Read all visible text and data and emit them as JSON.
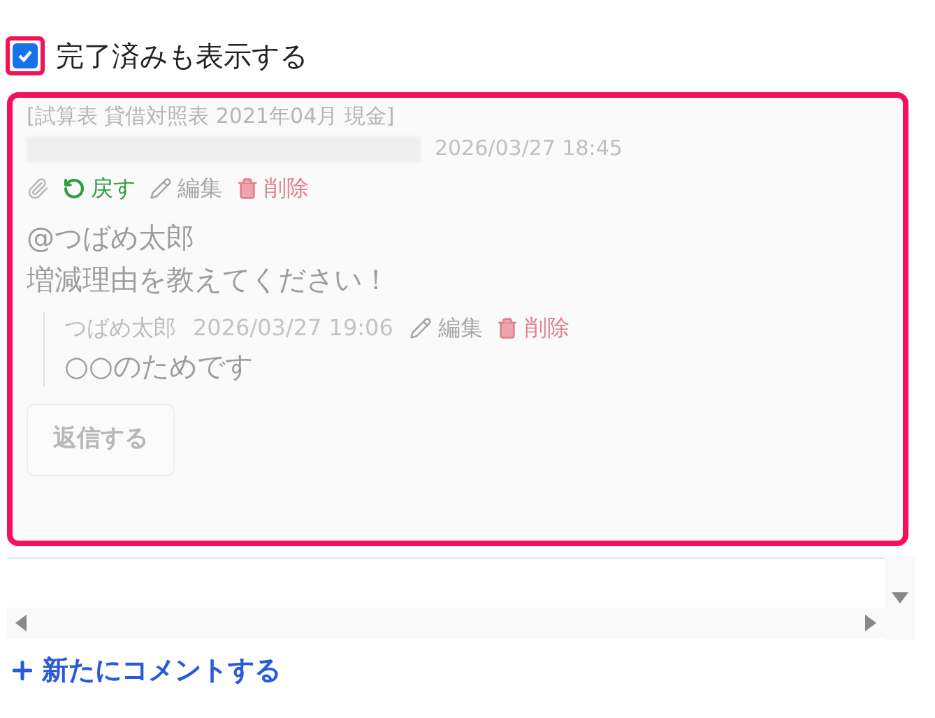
{
  "show_completed": {
    "label": "完了済みも表示する",
    "checked": true
  },
  "thread": {
    "title": "[試算表 貸借対照表 2021年04月 現金]",
    "timestamp": "2026/03/27 18:45",
    "actions": [
      {
        "kind": "attach"
      },
      {
        "kind": "revert",
        "label": "戻す"
      },
      {
        "kind": "edit",
        "label": "編集"
      },
      {
        "kind": "delete",
        "label": "削除"
      }
    ],
    "body": [
      "@つばめ太郎",
      "増減理由を教えてください！"
    ],
    "replies": [
      {
        "author": "つばめ太郎",
        "timestamp": "2026/03/27 19:06",
        "actions": [
          {
            "kind": "edit",
            "label": "編集"
          },
          {
            "kind": "delete",
            "label": "削除"
          }
        ],
        "body": "○○のためです"
      }
    ],
    "reply_button": {
      "label": "返信する",
      "disabled": true
    }
  },
  "new_comment": {
    "label": "新たにコメントする"
  }
}
